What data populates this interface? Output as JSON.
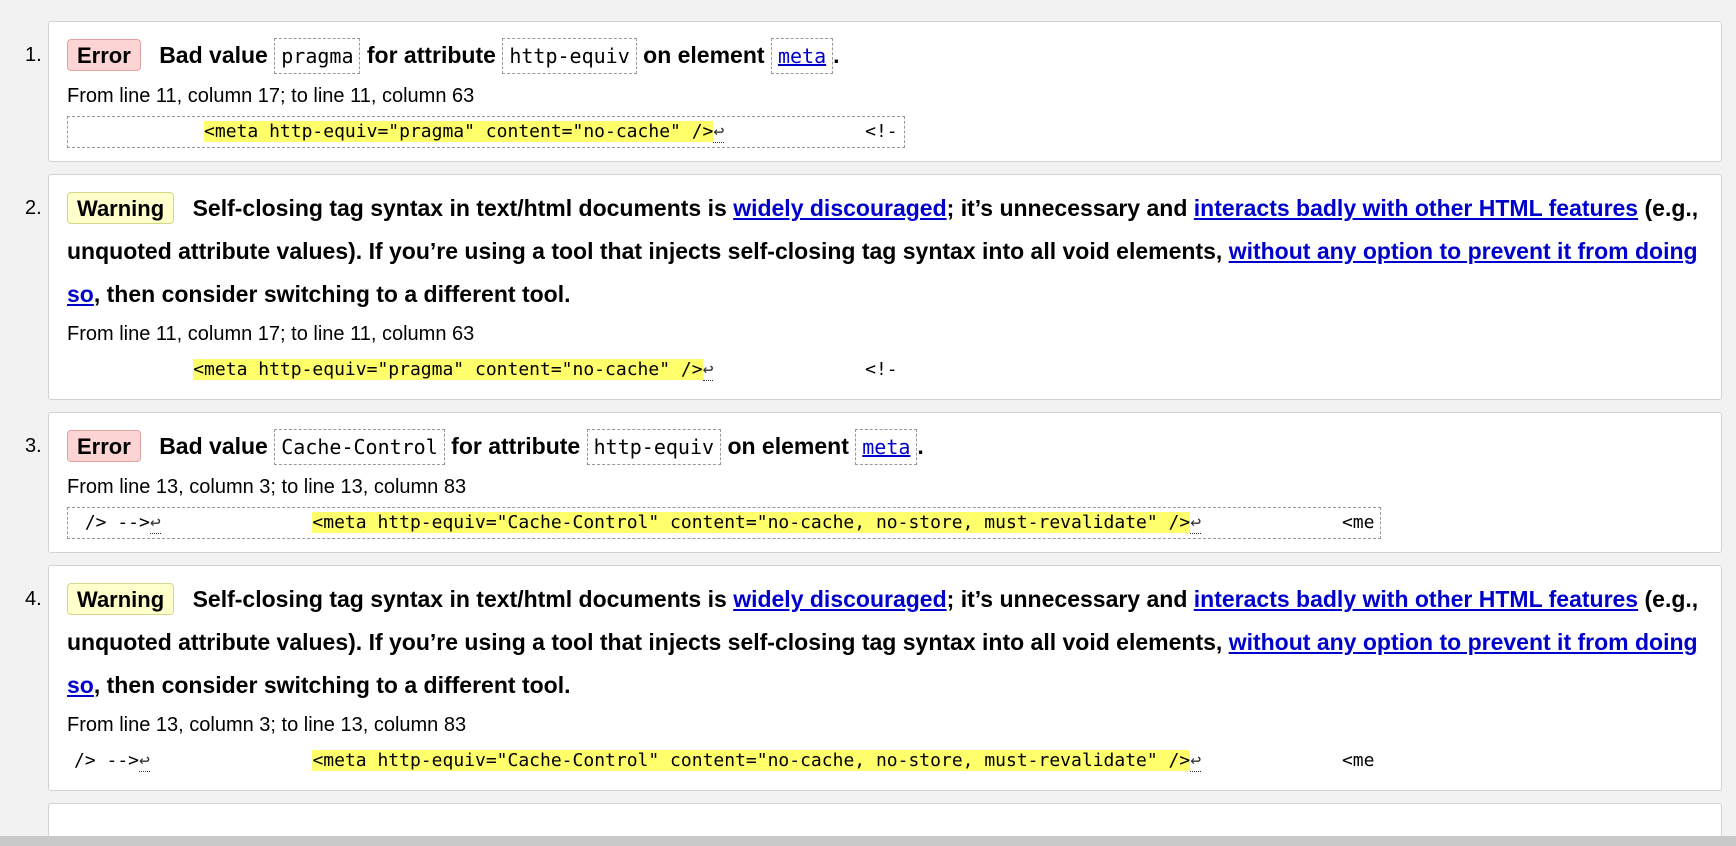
{
  "messages": [
    {
      "number": "1.",
      "badge": "Error",
      "text_1": "Bad value",
      "code_1": "pragma",
      "text_2": "for attribute",
      "code_2": "http-equiv",
      "text_3": "on element",
      "link_code": "meta",
      "text_end": ".",
      "location": "From line 11, column 17; to line 11, column 63",
      "extract_before": "            ",
      "extract_highlight": "<meta http-equiv=\"pragma\" content=\"no-cache\" />",
      "extract_lf": "↩",
      "extract_after": "             <!-"
    },
    {
      "number": "2.",
      "badge": "Warning",
      "text_1": "Self-closing tag syntax in text/html documents is",
      "link_1": "widely discouraged",
      "text_2": "; it’s unnecessary and",
      "link_2": "interacts badly with other HTML features",
      "text_3": "(e.g., unquoted attribute values). If you’re using a tool that injects self-closing tag syntax into all void elements,",
      "link_3": "without any option to prevent it from doing so",
      "text_4": ", then consider switching to a different tool.",
      "location": "From line 11, column 17; to line 11, column 63",
      "extract_before": "           ",
      "extract_highlight": "<meta http-equiv=\"pragma\" content=\"no-cache\" />",
      "extract_lf": "↩",
      "extract_after": "              <!-"
    },
    {
      "number": "3.",
      "badge": "Error",
      "text_1": "Bad value",
      "code_1": "Cache-Control",
      "text_2": "for attribute",
      "code_2": "http-equiv",
      "text_3": "on element",
      "link_code": "meta",
      "text_end": ".",
      "location": "From line 13, column 3; to line 13, column 83",
      "extract_before": " /> -->",
      "extract_lf_1": "↩",
      "extract_gap": "              ",
      "extract_highlight": "<meta http-equiv=\"Cache-Control\" content=\"no-cache, no-store, must-revalidate\" />",
      "extract_lf": "↩",
      "extract_after": "             <me"
    },
    {
      "number": "4.",
      "badge": "Warning",
      "text_1": "Self-closing tag syntax in text/html documents is",
      "link_1": "widely discouraged",
      "text_2": "; it’s unnecessary and",
      "link_2": "interacts badly with other HTML features",
      "text_3": "(e.g., unquoted attribute values). If you’re using a tool that injects self-closing tag syntax into all void elements,",
      "link_3": "without any option to prevent it from doing so",
      "text_4": ", then consider switching to a different tool.",
      "location": "From line 13, column 3; to line 13, column 83",
      "extract_before": "/> -->",
      "extract_lf_1": "↩",
      "extract_gap": "               ",
      "extract_highlight": "<meta http-equiv=\"Cache-Control\" content=\"no-cache, no-store, must-revalidate\" />",
      "extract_lf": "↩",
      "extract_after": "             <me"
    }
  ],
  "colors": {
    "error_badge": "#fcd4d4",
    "warning_badge": "#ffffcc",
    "highlight": "#ffff6b",
    "link": "#0000cc"
  }
}
